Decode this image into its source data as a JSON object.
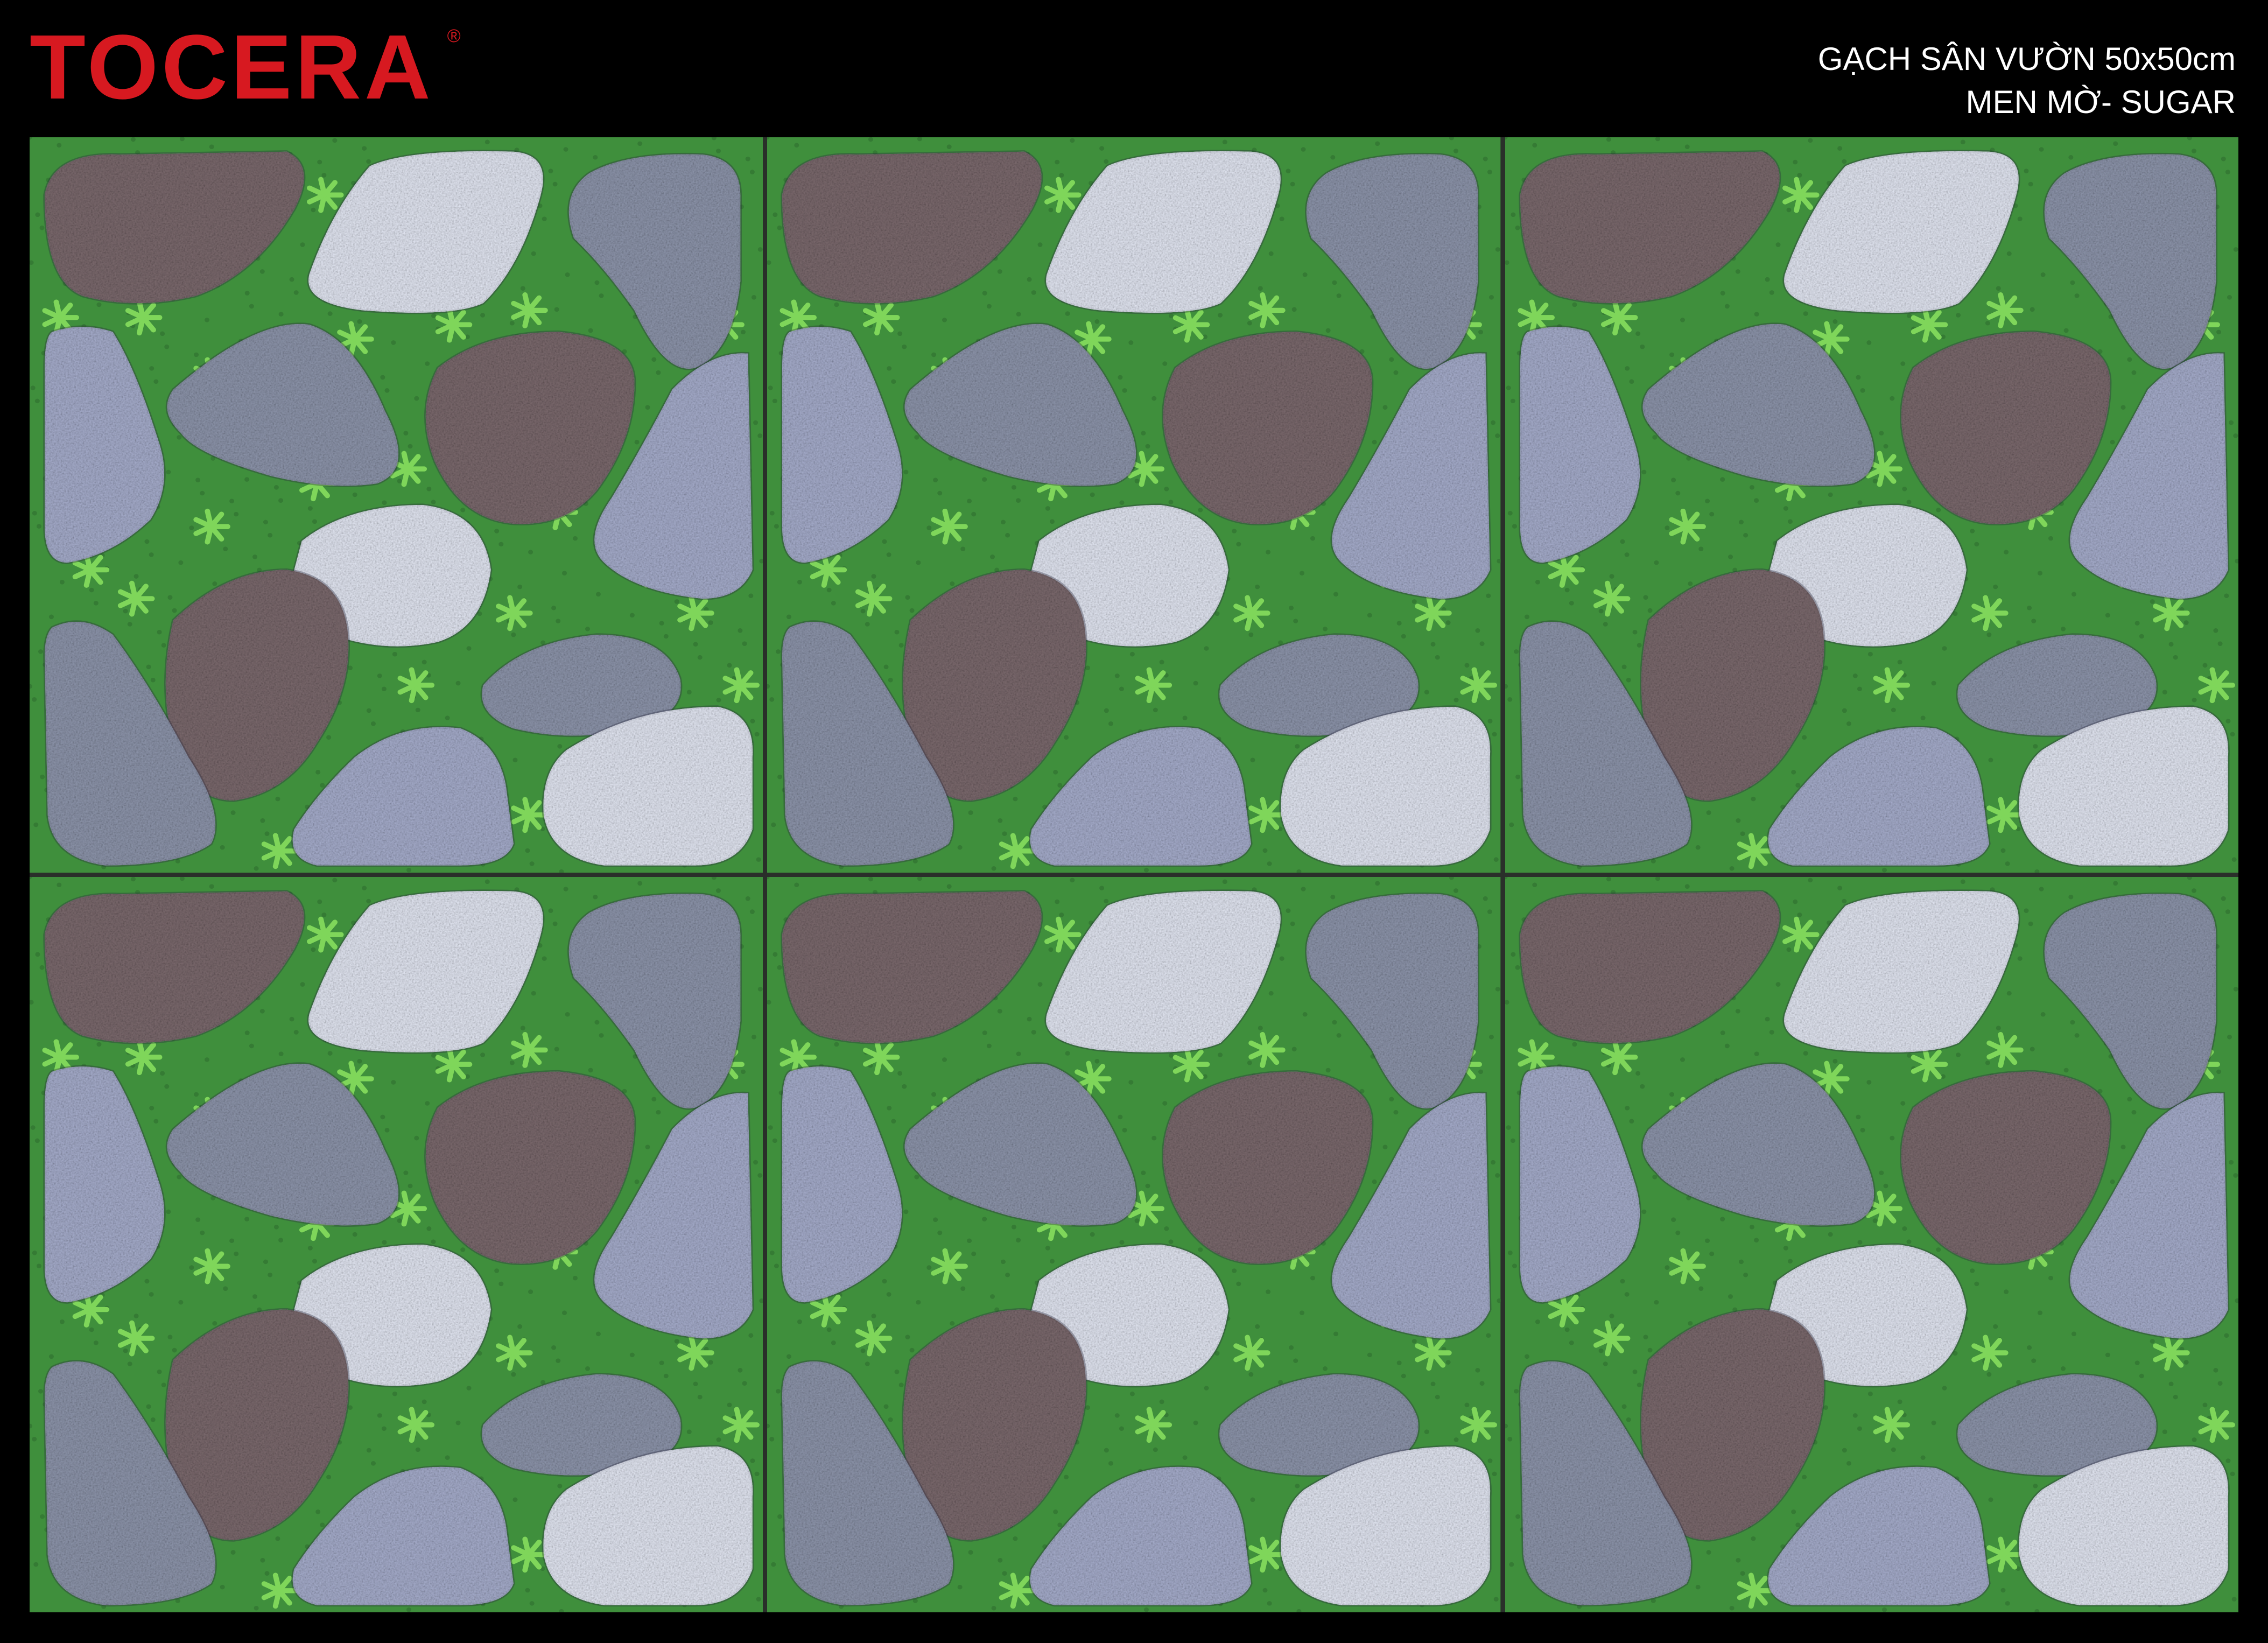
{
  "brand": {
    "name": "TOCERA",
    "registered_mark": "®",
    "color": "#d71920"
  },
  "product": {
    "line1": "GẠCH SÂN VƯỜN 50x50cm",
    "line2": "MEN MỜ- SUGAR"
  },
  "tiles": {
    "rows": 2,
    "columns": 3,
    "grass_color": "#3f8f3c",
    "leaf_color": "#7fd65a",
    "stone_colors": {
      "brown_granite": "#7c6a6e",
      "white_pebble": "#e4e8f4",
      "grey_marble": "#8e96ac",
      "blue_speckled": "#a7aecd"
    }
  }
}
